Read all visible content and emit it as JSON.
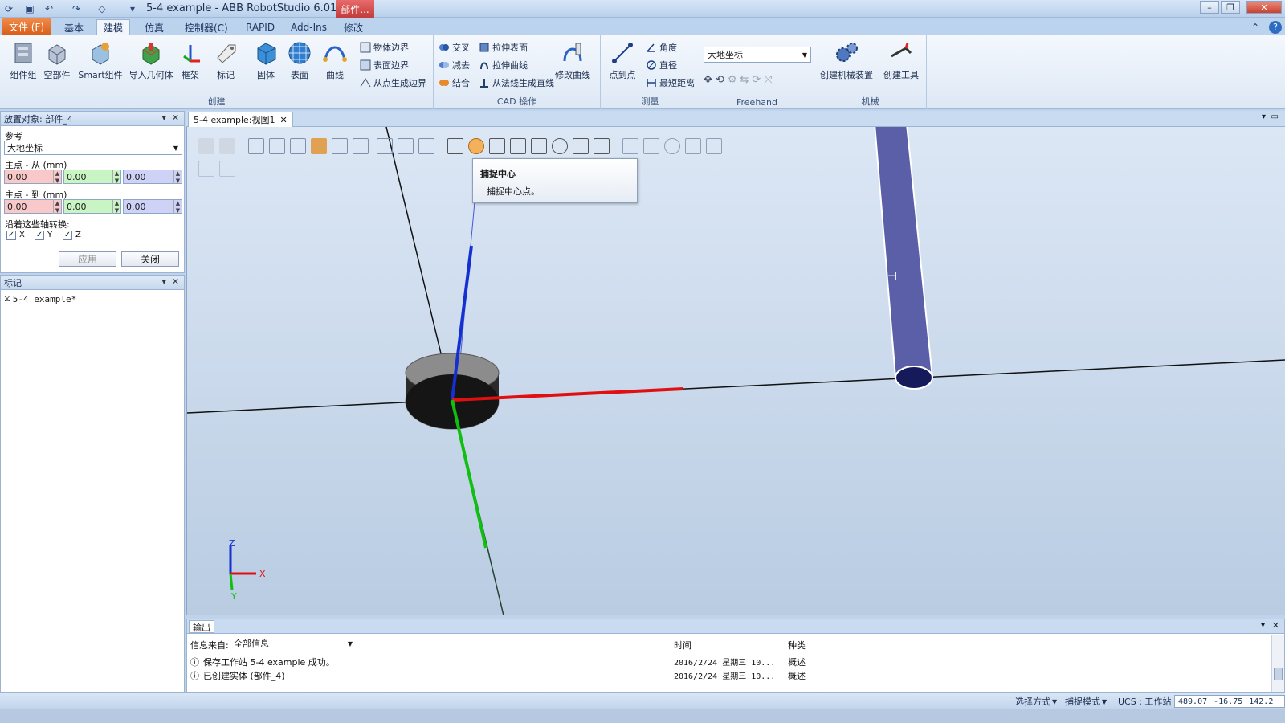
{
  "window": {
    "title": "5-4 example - ABB RobotStudio 6.01.01",
    "context_tab": "部件..."
  },
  "ribbon_tabs": [
    "文件 (F)",
    "基本",
    "建模",
    "仿真",
    "控制器(C)",
    "RAPID",
    "Add-Ins",
    "修改"
  ],
  "ribbon": {
    "create": {
      "label": "创建",
      "buttons": [
        "组件组",
        "空部件",
        "Smart组件",
        "导入几何体",
        "框架",
        "标记",
        "固体",
        "表面",
        "曲线"
      ],
      "small": [
        "物体边界",
        "表面边界",
        "从点生成边界"
      ]
    },
    "cad": {
      "label": "CAD 操作",
      "small_a": [
        "交叉",
        "减去",
        "结合"
      ],
      "small_b": [
        "拉伸表面",
        "拉伸曲线",
        "从法线生成直线"
      ],
      "modify_curve": "修改曲线"
    },
    "measure": {
      "label": "测量",
      "point_to_point": "点到点",
      "small": [
        "角度",
        "直径",
        "最短距离"
      ]
    },
    "freehand": {
      "label": "Freehand",
      "dropdown": "大地坐标"
    },
    "mechanism": {
      "label": "机械",
      "buttons": [
        "创建机械装置",
        "创建工具"
      ]
    }
  },
  "place_panel": {
    "title": "放置对象: 部件_4",
    "reference_label": "参考",
    "reference_value": "大地坐标",
    "from_label": "主点 - 从 (mm)",
    "from_values": [
      "0.00",
      "0.00",
      "0.00"
    ],
    "to_label": "主点 - 到 (mm)",
    "to_values": [
      "0.00",
      "0.00",
      "0.00"
    ],
    "axes_label": "沿着这些轴转换:",
    "axes": [
      "X",
      "Y",
      "Z"
    ],
    "apply": "应用",
    "close": "关闭"
  },
  "tags_panel": {
    "title": "标记",
    "item": "5-4 example*"
  },
  "viewport": {
    "tab": "5-4 example:视图1",
    "tooltip_title": "捕捉中心",
    "tooltip_body": "捕捉中心点。",
    "triad": {
      "z": "Z",
      "x": "X",
      "y": "Y"
    }
  },
  "output": {
    "tab": "输出",
    "source_label": "信息来自:",
    "source_value": "全部信息",
    "col_time": "时间",
    "col_type": "种类",
    "rows": [
      {
        "msg": "保存工作站 5-4 example 成功。",
        "time": "2016/2/24 星期三 10...",
        "type": "概述"
      },
      {
        "msg": "已创建实体 (部件_4)",
        "time": "2016/2/24 星期三 10...",
        "type": "概述"
      }
    ]
  },
  "status": {
    "select_mode": "选择方式",
    "snap_mode": "捕捉模式",
    "ucs": "UCS : 工作站",
    "coords": [
      "489.07",
      "-16.75",
      "142.2"
    ]
  },
  "colors": {
    "x_axis": "#e01010",
    "y_axis": "#10c010",
    "z_axis": "#1530d0",
    "cylinder": "#5a5fa8",
    "accent_file": "#e2722c"
  }
}
